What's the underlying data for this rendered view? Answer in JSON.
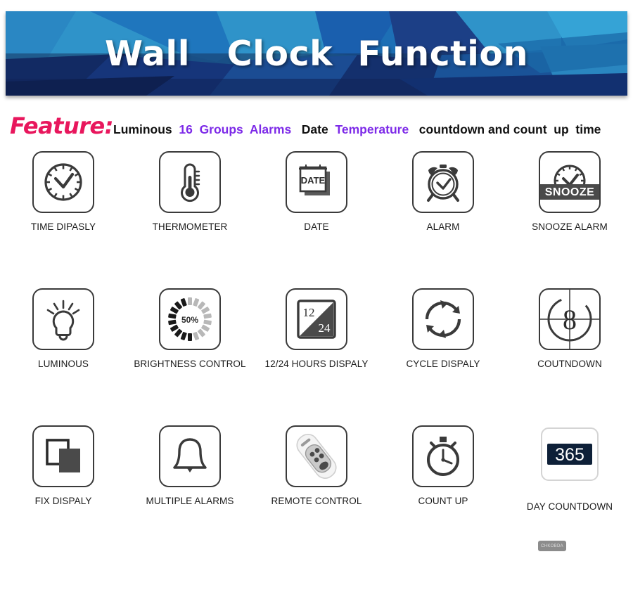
{
  "banner": {
    "title": "Wall   Clock  Function",
    "colors": {
      "base": "#1b5fa8",
      "light": "#2f93c9",
      "mid": "#1f76bd",
      "dark": "#16356e",
      "darker": "#10255a",
      "teal": "#1a6f93"
    }
  },
  "feature": {
    "label": "Feature:",
    "label_color": "#e8175d",
    "segments": [
      {
        "text": "Luminous",
        "color": "black"
      },
      {
        "text": "  ",
        "color": "black"
      },
      {
        "text": "16  Groups  Alarms",
        "color": "purple"
      },
      {
        "text": "   ",
        "color": "black"
      },
      {
        "text": "Date",
        "color": "black"
      },
      {
        "text": "  ",
        "color": "black"
      },
      {
        "text": "Temperature",
        "color": "purple"
      },
      {
        "text": "   countdown and count  up  time",
        "color": "black"
      }
    ],
    "purple_hex": "#7d2ae8",
    "black_hex": "#111111"
  },
  "grid": {
    "rows": [
      [
        {
          "icon": "clock-icon",
          "label": "TIME DIPASLY"
        },
        {
          "icon": "thermometer-icon",
          "label": "THERMOMETER"
        },
        {
          "icon": "calendar-date-icon",
          "label": "DATE",
          "icon_text": "DATE"
        },
        {
          "icon": "alarm-clock-icon",
          "label": "ALARM"
        },
        {
          "icon": "snooze-alarm-icon",
          "label": "SNOOZE ALARM",
          "icon_text": "SNOOZE"
        }
      ],
      [
        {
          "icon": "lightbulb-icon",
          "label": "LUMINOUS"
        },
        {
          "icon": "brightness-dial-icon",
          "label": "BRIGHTNESS CONTROL",
          "icon_text": "50%"
        },
        {
          "icon": "twelve-twentyfour-icon",
          "label": "12/24 HOURS DISPALY",
          "icon_text_a": "12",
          "icon_text_b": "24"
        },
        {
          "icon": "cycle-arrows-icon",
          "label": "CYCLE DISPALY"
        },
        {
          "icon": "film-countdown-icon",
          "label": "COUTNDOWN",
          "icon_text": "8"
        }
      ],
      [
        {
          "icon": "overlapping-squares-icon",
          "label": "FIX DISPALY"
        },
        {
          "icon": "bell-icon",
          "label": "MULTIPLE ALARMS"
        },
        {
          "icon": "remote-control-icon",
          "label": "REMOTE CONTROL"
        },
        {
          "icon": "stopwatch-icon",
          "label": "COUNT UP"
        },
        {
          "icon": "day-countdown-icon",
          "label": "DAY COUNTDOWN",
          "icon_text": "365"
        }
      ]
    ]
  },
  "watermark": {
    "text": "CHKOBDA"
  }
}
